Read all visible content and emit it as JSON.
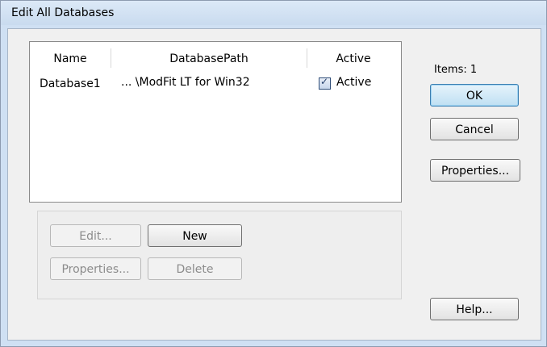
{
  "window": {
    "title": "Edit All Databases"
  },
  "list": {
    "columns": [
      "Name",
      "DatabasePath",
      "Active"
    ],
    "rows": [
      {
        "name": "Database1",
        "path": "... \\ModFit LT for Win32",
        "active_label": "Active",
        "active": true
      }
    ]
  },
  "buttons": {
    "edit": "Edit...",
    "new": "New",
    "properties_left": "Properties...",
    "delete": "Delete",
    "ok": "OK",
    "cancel": "Cancel",
    "properties_right": "Properties...",
    "help": "Help..."
  },
  "items_label": "Items: 1"
}
